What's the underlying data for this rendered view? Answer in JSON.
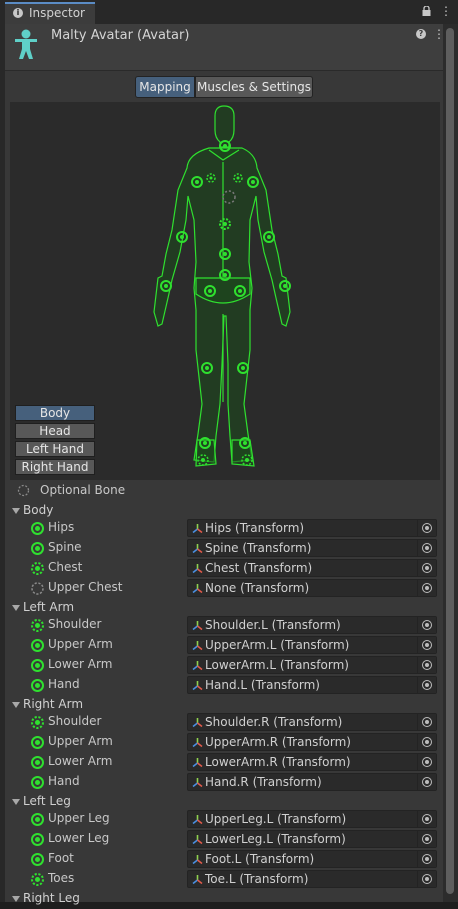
{
  "tab": {
    "title": "Inspector",
    "icon": "info-icon"
  },
  "header": {
    "title": "Malty Avatar (Avatar)",
    "icon": "avatar-figure-icon"
  },
  "toolbar": {
    "mapping_label": "Mapping",
    "muscles_label": "Muscles & Settings"
  },
  "view_buttons": [
    {
      "label": "Body",
      "active": true
    },
    {
      "label": "Head",
      "active": false
    },
    {
      "label": "Left Hand",
      "active": false
    },
    {
      "label": "Right Hand",
      "active": false
    }
  ],
  "legend": {
    "optional_bone_label": "Optional Bone"
  },
  "groups": [
    {
      "label": "Body",
      "bones": [
        {
          "name": "Hips",
          "value": "Hips (Transform)",
          "status": "required"
        },
        {
          "name": "Spine",
          "value": "Spine (Transform)",
          "status": "required"
        },
        {
          "name": "Chest",
          "value": "Chest (Transform)",
          "status": "optional-assigned"
        },
        {
          "name": "Upper Chest",
          "value": "None (Transform)",
          "status": "optional-empty"
        }
      ]
    },
    {
      "label": "Left Arm",
      "bones": [
        {
          "name": "Shoulder",
          "value": "Shoulder.L (Transform)",
          "status": "optional-assigned"
        },
        {
          "name": "Upper Arm",
          "value": "UpperArm.L (Transform)",
          "status": "required"
        },
        {
          "name": "Lower Arm",
          "value": "LowerArm.L (Transform)",
          "status": "required"
        },
        {
          "name": "Hand",
          "value": "Hand.L (Transform)",
          "status": "required"
        }
      ]
    },
    {
      "label": "Right Arm",
      "bones": [
        {
          "name": "Shoulder",
          "value": "Shoulder.R (Transform)",
          "status": "optional-assigned"
        },
        {
          "name": "Upper Arm",
          "value": "UpperArm.R (Transform)",
          "status": "required"
        },
        {
          "name": "Lower Arm",
          "value": "LowerArm.R (Transform)",
          "status": "required"
        },
        {
          "name": "Hand",
          "value": "Hand.R (Transform)",
          "status": "required"
        }
      ]
    },
    {
      "label": "Left Leg",
      "bones": [
        {
          "name": "Upper Leg",
          "value": "UpperLeg.L (Transform)",
          "status": "required"
        },
        {
          "name": "Lower Leg",
          "value": "LowerLeg.L (Transform)",
          "status": "required"
        },
        {
          "name": "Foot",
          "value": "Foot.L (Transform)",
          "status": "required"
        },
        {
          "name": "Toes",
          "value": "Toe.L (Transform)",
          "status": "optional-assigned"
        }
      ]
    },
    {
      "label": "Right Leg",
      "bones": []
    }
  ],
  "colors": {
    "bone_green": "#2fe02f",
    "accent_blue": "#46607c"
  }
}
